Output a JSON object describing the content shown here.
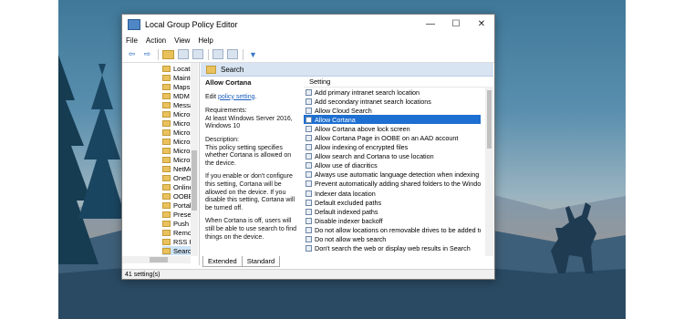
{
  "window": {
    "title": "Local Group Policy Editor",
    "minimize_glyph": "—",
    "maximize_glyph": "☐",
    "close_glyph": "✕"
  },
  "menu": [
    "File",
    "Action",
    "View",
    "Help"
  ],
  "toolbar": {
    "back_glyph": "⇦",
    "forward_glyph": "⇨",
    "filter_glyph": "▼"
  },
  "tree": {
    "items": [
      {
        "label": "Locatio"
      },
      {
        "label": "Mainte"
      },
      {
        "label": "Maps"
      },
      {
        "label": "MDM"
      },
      {
        "label": "Messa"
      },
      {
        "label": "Micros"
      },
      {
        "label": "Micros"
      },
      {
        "label": "Micros"
      },
      {
        "label": "Micros"
      },
      {
        "label": "Micros"
      },
      {
        "label": "Micros"
      },
      {
        "label": "NetMe"
      },
      {
        "label": "OneDr"
      },
      {
        "label": "Online"
      },
      {
        "label": "OOBE"
      },
      {
        "label": "Portab"
      },
      {
        "label": "Presen"
      },
      {
        "label": "Push T"
      },
      {
        "label": "Remot"
      },
      {
        "label": "RSS Fe"
      },
      {
        "label": "Search"
      }
    ]
  },
  "header": {
    "title": "Search"
  },
  "description": {
    "title": "Allow Cortana",
    "edit_prefix": "Edit ",
    "edit_link": "policy setting",
    "edit_suffix": ".",
    "requirements": "Requirements:",
    "requirements_value": "At least Windows Server 2016, Windows 10",
    "desc_label": "Description:",
    "p1": "This policy setting specifies whether Cortana is allowed on the device.",
    "p2": "If you enable or don't configure this setting, Cortana will be allowed on the device. If you disable this setting, Cortana will be turned off.",
    "p3": "When Cortana is off, users will still be able to use search to find things on the device."
  },
  "list": {
    "column": "Setting",
    "rows": [
      {
        "label": "Add primary intranet search location"
      },
      {
        "label": "Add secondary intranet search locations"
      },
      {
        "label": "Allow Cloud Search"
      },
      {
        "label": "Allow Cortana"
      },
      {
        "label": "Allow Cortana above lock screen"
      },
      {
        "label": "Allow Cortana Page in OOBE on an AAD account"
      },
      {
        "label": "Allow indexing of encrypted files"
      },
      {
        "label": "Allow search and Cortana to use location"
      },
      {
        "label": "Allow use of diacritics"
      },
      {
        "label": "Always use automatic language detection when indexing co..."
      },
      {
        "label": "Prevent automatically adding shared folders to the Window..."
      },
      {
        "label": "Indexer data location"
      },
      {
        "label": "Default excluded paths"
      },
      {
        "label": "Default indexed paths"
      },
      {
        "label": "Disable indexer backoff"
      },
      {
        "label": "Do not allow locations on removable drives to be added to li..."
      },
      {
        "label": "Do not allow web search"
      },
      {
        "label": "Don't search the web or display web results in Search"
      }
    ],
    "selected_index": 3
  },
  "tabs": [
    "Extended",
    "Standard"
  ],
  "status": "41 setting(s)",
  "colors": {
    "selection": "#1d6fd1",
    "header": "#d8e4f2",
    "folder": "#e9c25e"
  }
}
